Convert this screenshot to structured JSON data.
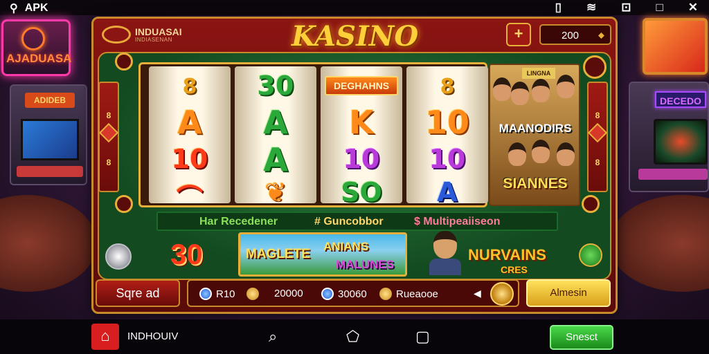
{
  "statusbar": {
    "app_label": "APK"
  },
  "background": {
    "left_sign": "AJADUASA",
    "left_cabinet_marquee": "ADIDEB",
    "right_cabinet_marquee": "DECEDO"
  },
  "header": {
    "brand_name": "INDUASAI",
    "brand_sub": "INDIASENAN",
    "title": "KASINO",
    "plus_label": "+",
    "balance": "200",
    "balance_arrow": "⬥"
  },
  "side": {
    "top_num": "8",
    "bottom_num": "8"
  },
  "reels": [
    {
      "top": "8",
      "rows": [
        "A",
        "10",
        "⌒"
      ]
    },
    {
      "top": "30",
      "rows": [
        "A",
        "A",
        "❦"
      ]
    },
    {
      "banner": "DEGHAHNS",
      "rows": [
        "K",
        "10",
        "SO"
      ]
    },
    {
      "top": "8",
      "rows": [
        "10",
        "10",
        "A"
      ]
    }
  ],
  "promo_side": {
    "tag": "LINGNA",
    "line1": "MAANODIRS",
    "line2": "SIANNES"
  },
  "info_strip": {
    "item1": "Har Recedener",
    "item2": "# Guncobbor",
    "item3": "$ Multipeaiiseon"
  },
  "jackpot": "30",
  "promo_banner": {
    "line1": "MAGLETE",
    "line2": "ANIANS",
    "line3": "MALUNES"
  },
  "bonus": {
    "line1": "NURVAINS",
    "line2": "CRES"
  },
  "bottom": {
    "left_button": "Sqre ad",
    "bet1": "R10",
    "bet2": "20000",
    "bet3": "30060",
    "bet4": "Rueaooe",
    "arrow": "◀",
    "right_button": "Almesin"
  },
  "navbar": {
    "home_label": "INDHOUIV",
    "action_button": "Snesct"
  }
}
